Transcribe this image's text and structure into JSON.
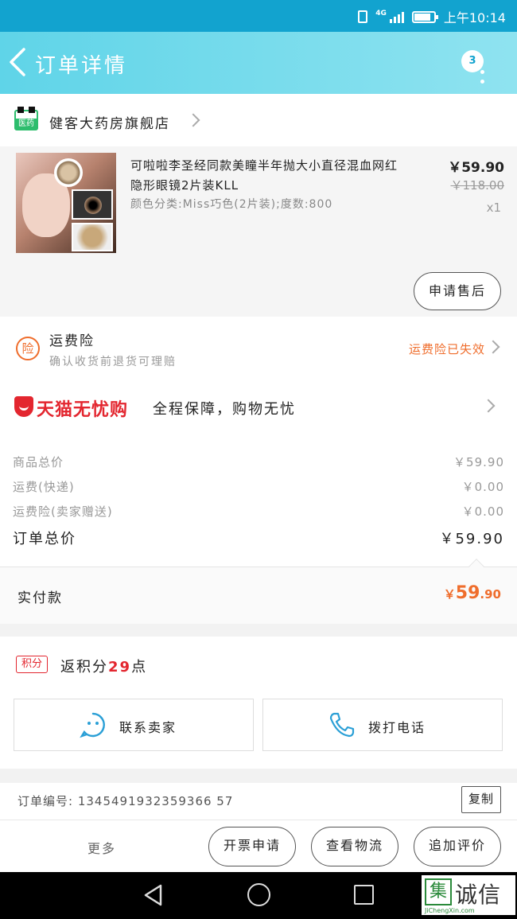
{
  "status_bar": {
    "network": "4G",
    "time": "上午10:14",
    "battery_level": 0.85
  },
  "header": {
    "title": "订单详情",
    "badge_count": "3"
  },
  "store": {
    "icon_label": "医药",
    "name": "健客大药房旗舰店"
  },
  "product": {
    "title": "可啦啦李圣经同款美瞳半年抛大小直径混血网红隐形眼镜2片装KLL",
    "spec": "颜色分类:Miss巧色(2片装);度数:800",
    "price": "￥59.90",
    "original_price": "￥118.00",
    "quantity": "x1",
    "aftersale_button": "申请售后"
  },
  "freight_insurance": {
    "icon_label": "险",
    "title": "运费险",
    "subtitle": "确认收货前退货可理赔",
    "status": "运费险已失效"
  },
  "tmall": {
    "brand": "天猫无忧购",
    "desc": "全程保障，购物无忧"
  },
  "summary": {
    "rows": [
      {
        "label": "商品总价",
        "value": "￥59.90"
      },
      {
        "label": "运费(快递)",
        "value": "￥0.00"
      },
      {
        "label": "运费险(卖家赠送)",
        "value": "￥0.00"
      }
    ],
    "total_label": "订单总价",
    "total_value": "￥59.90"
  },
  "payment": {
    "label": "实付款",
    "currency": "￥",
    "amount_int": "59",
    "amount_dec": ".90"
  },
  "points": {
    "badge": "积分",
    "prefix": "返积分",
    "value": "29",
    "suffix": "点"
  },
  "actions": {
    "contact_seller": "联系卖家",
    "call_phone": "拨打电话"
  },
  "order": {
    "number_label": "订单编号:",
    "number": "1345491932359366 57",
    "copy_button": "复制"
  },
  "bottom_bar": {
    "more": "更多",
    "invoice": "开票申请",
    "logistics": "查看物流",
    "review": "追加评价"
  },
  "watermark": {
    "box": "集",
    "text": "诚信",
    "url": "JiChengXin.com"
  },
  "colors": {
    "accent": "#12a3cf",
    "header": "#5fd4e8",
    "orange": "#ef6d2c",
    "red": "#e3262f"
  }
}
